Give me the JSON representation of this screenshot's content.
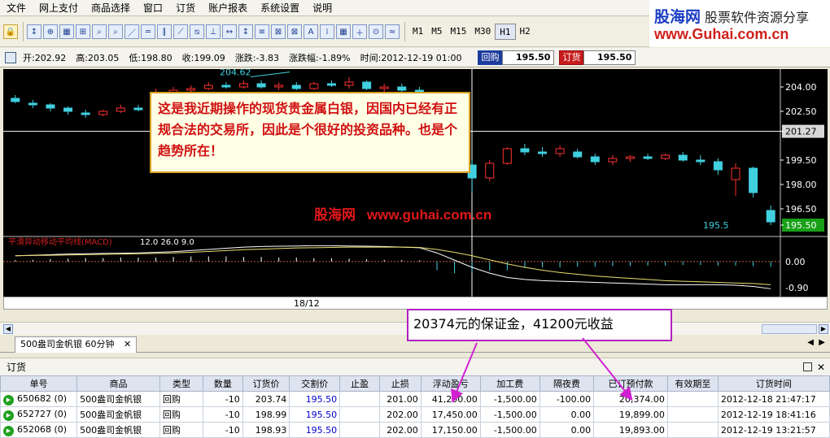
{
  "menu": [
    "文件",
    "网上支付",
    "商品选择",
    "窗口",
    "订货",
    "账户报表",
    "系统设置",
    "说明"
  ],
  "logo": {
    "name": "股海网",
    "slogan": "股票软件资源分享",
    "url": "www.Guhai.com.cn"
  },
  "periods": [
    "M1",
    "M5",
    "M15",
    "M30",
    "H1",
    "H2"
  ],
  "active_period": "H1",
  "quote": {
    "open": "开:202.92",
    "high": "高:203.05",
    "low": "低:198.80",
    "close": "收:199.09",
    "change": "涨跌:-3.83",
    "change_pct": "涨跌幅:-1.89%",
    "time": "时间:2012-12-19 01:00",
    "buyback_label": "回购",
    "buyback_price": "195.50",
    "order_label": "订货",
    "order_price": "195.50"
  },
  "chart_data": {
    "type": "candlestick",
    "y_ticks": [
      "204.00",
      "202.50",
      "201.27",
      "199.50",
      "198.00",
      "196.50",
      "195.50"
    ],
    "current_price_label": "201.27",
    "last_price_label": "195.50",
    "high_label": "204.62",
    "low_label": "195.5",
    "ylim": [
      195.0,
      205.0
    ],
    "candles": [
      [
        203.3,
        203.5,
        203.0,
        203.1
      ],
      [
        203.0,
        203.2,
        202.7,
        202.9
      ],
      [
        202.9,
        203.0,
        202.5,
        202.7
      ],
      [
        202.7,
        202.8,
        202.3,
        202.5
      ],
      [
        202.4,
        202.6,
        202.1,
        202.3
      ],
      [
        202.3,
        202.6,
        202.2,
        202.5
      ],
      [
        202.5,
        202.9,
        202.4,
        202.7
      ],
      [
        202.7,
        202.9,
        202.5,
        202.6
      ],
      [
        202.6,
        203.9,
        202.5,
        203.6
      ],
      [
        203.6,
        204.0,
        203.4,
        203.8
      ],
      [
        203.8,
        204.1,
        203.6,
        203.9
      ],
      [
        203.9,
        204.3,
        203.8,
        204.1
      ],
      [
        204.1,
        204.3,
        203.9,
        204.0
      ],
      [
        204.0,
        204.4,
        203.9,
        204.2
      ],
      [
        204.2,
        204.4,
        203.9,
        204.0
      ],
      [
        204.0,
        204.3,
        203.8,
        204.1
      ],
      [
        204.1,
        204.3,
        203.8,
        203.9
      ],
      [
        203.9,
        204.3,
        203.8,
        204.2
      ],
      [
        204.2,
        204.4,
        204.0,
        204.1
      ],
      [
        204.1,
        204.6,
        203.9,
        204.3
      ],
      [
        204.3,
        204.4,
        203.8,
        203.9
      ],
      [
        203.9,
        204.2,
        203.7,
        204.0
      ],
      [
        204.0,
        204.2,
        203.7,
        203.8
      ],
      [
        203.8,
        204.0,
        203.3,
        203.5
      ],
      [
        203.5,
        203.7,
        200.2,
        200.5
      ],
      [
        199.9,
        200.8,
        199.0,
        199.2
      ],
      [
        199.2,
        199.5,
        197.5,
        198.4
      ],
      [
        198.4,
        199.5,
        198.2,
        199.3
      ],
      [
        199.3,
        200.3,
        199.2,
        200.2
      ],
      [
        200.2,
        200.5,
        199.8,
        200.0
      ],
      [
        200.0,
        200.3,
        199.7,
        199.9
      ],
      [
        199.9,
        200.4,
        199.7,
        200.2
      ],
      [
        200.0,
        200.2,
        199.6,
        199.7
      ],
      [
        199.7,
        199.9,
        199.2,
        199.4
      ],
      [
        199.4,
        199.8,
        199.2,
        199.6
      ],
      [
        199.6,
        199.8,
        199.4,
        199.7
      ],
      [
        199.7,
        199.9,
        199.5,
        199.6
      ],
      [
        199.6,
        199.9,
        199.5,
        199.8
      ],
      [
        199.8,
        200.0,
        199.4,
        199.5
      ],
      [
        199.5,
        199.8,
        199.2,
        199.4
      ],
      [
        199.4,
        199.6,
        198.6,
        198.9
      ],
      [
        198.3,
        199.3,
        197.3,
        199.0
      ],
      [
        199.0,
        199.1,
        197.2,
        197.5
      ],
      [
        196.4,
        196.7,
        195.5,
        195.7
      ]
    ],
    "macd_label": "平滑异动移动平均线(MACD)",
    "macd_params": "12.0 26.0 9.0",
    "macd_ticks": [
      "0.00",
      "-0.90"
    ],
    "macd_hist": [
      0.05,
      0.06,
      0.08,
      0.1,
      0.12,
      0.12,
      0.14,
      0.14,
      0.14,
      0.16,
      0.18,
      0.18,
      0.18,
      0.16,
      0.16,
      0.14,
      0.14,
      0.12,
      0.12,
      0.1,
      0.08,
      0.06,
      0.05,
      0.04,
      -0.3,
      -0.4,
      -0.38,
      -0.32,
      -0.3,
      -0.22,
      -0.2,
      -0.2,
      -0.18,
      -0.18,
      -0.16,
      -0.16,
      -0.14,
      -0.14,
      -0.12,
      -0.12,
      -0.14,
      -0.14,
      -0.16,
      -0.18
    ],
    "macd_line1": [
      0.2,
      0.22,
      0.24,
      0.26,
      0.27,
      0.28,
      0.29,
      0.3,
      0.32,
      0.34,
      0.38,
      0.42,
      0.46,
      0.5,
      0.52,
      0.53,
      0.54,
      0.55,
      0.55,
      0.54,
      0.53,
      0.52,
      0.5,
      0.48,
      0.3,
      0.05,
      -0.2,
      -0.4,
      -0.55,
      -0.62,
      -0.66,
      -0.68,
      -0.7,
      -0.72,
      -0.74,
      -0.76,
      -0.78,
      -0.8,
      -0.8,
      -0.8,
      -0.8,
      -0.82,
      -0.86,
      -0.94
    ],
    "macd_line2": [
      0.2,
      0.21,
      0.22,
      0.23,
      0.24,
      0.25,
      0.26,
      0.27,
      0.28,
      0.3,
      0.32,
      0.35,
      0.38,
      0.41,
      0.43,
      0.45,
      0.47,
      0.48,
      0.49,
      0.5,
      0.5,
      0.5,
      0.5,
      0.49,
      0.42,
      0.32,
      0.2,
      0.06,
      -0.08,
      -0.2,
      -0.3,
      -0.38,
      -0.44,
      -0.5,
      -0.54,
      -0.58,
      -0.62,
      -0.66,
      -0.68,
      -0.7,
      -0.72,
      -0.74,
      -0.76,
      -0.8
    ],
    "macd_ylim": [
      -1.1,
      0.7
    ],
    "x_label": "18/12"
  },
  "annotation1": "这是我近期操作的现货贵金属白银，因国内已经有正规合法的交易所，因此是个很好的投资品种。也是个趋势所在！",
  "annotation2": "20374元的保证金，41200元收益",
  "watermark": {
    "cn": "股海网",
    "url": "www.guhai.com.cn"
  },
  "tab_label": "500盎司金帆银 60分钟",
  "panel_title": "订货",
  "table": {
    "headers": [
      "单号",
      "商品",
      "类型",
      "数量",
      "订货价",
      "交割价",
      "止盈",
      "止损",
      "浮动盈亏",
      "加工费",
      "隔夜费",
      "已订预付款",
      "有效期至",
      "订货时间"
    ],
    "rows": [
      [
        "650682 (0)",
        "500盎司金帆银",
        "回购",
        "-10",
        "203.74",
        "195.50",
        "",
        "201.00",
        "41,200.00",
        "-1,500.00",
        "-100.00",
        "20,374.00",
        "",
        "2012-12-18 21:47:17"
      ],
      [
        "652727 (0)",
        "500盎司金帆银",
        "回购",
        "-10",
        "198.99",
        "195.50",
        "",
        "202.00",
        "17,450.00",
        "-1,500.00",
        "0.00",
        "19,899.00",
        "",
        "2012-12-19 18:41:16"
      ],
      [
        "652068 (0)",
        "500盎司金帆银",
        "回购",
        "-10",
        "198.93",
        "195.50",
        "",
        "202.00",
        "17,150.00",
        "-1,500.00",
        "0.00",
        "19,893.00",
        "",
        "2012-12-19 13:21:57"
      ]
    ]
  }
}
